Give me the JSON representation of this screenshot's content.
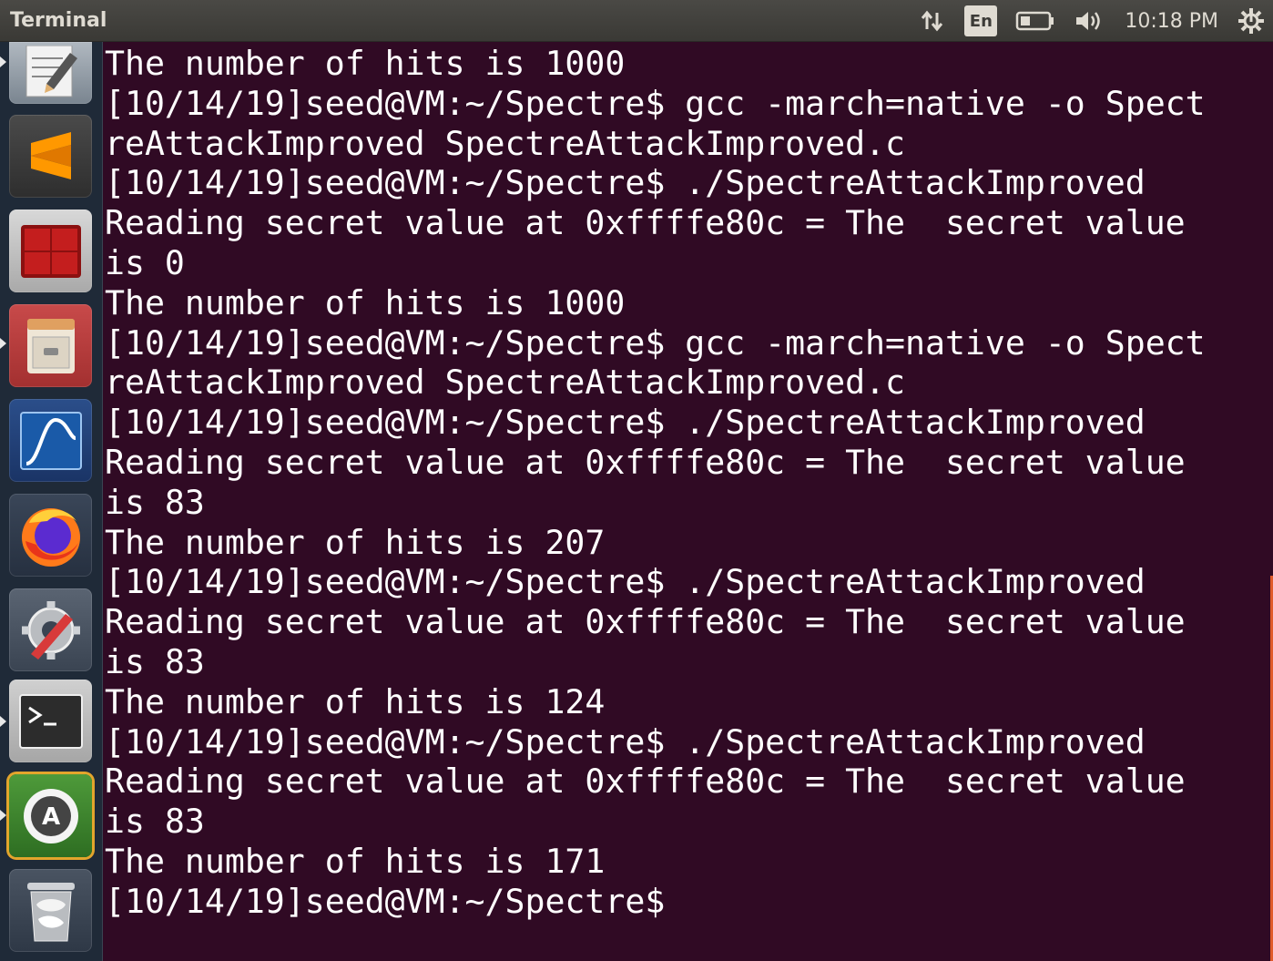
{
  "topbar": {
    "title": "Terminal",
    "keyboard_layout": "En",
    "clock": "10:18 PM"
  },
  "launcher": {
    "items": [
      {
        "name": "text-editor",
        "icon": "text-editor-icon"
      },
      {
        "name": "sublime-text",
        "icon": "sublime-text-icon"
      },
      {
        "name": "terminator",
        "icon": "terminator-icon"
      },
      {
        "name": "file-cabinet",
        "icon": "file-cabinet-icon"
      },
      {
        "name": "wireshark",
        "icon": "wireshark-icon"
      },
      {
        "name": "firefox",
        "icon": "firefox-icon"
      },
      {
        "name": "system-settings",
        "icon": "settings-icon"
      },
      {
        "name": "terminal",
        "icon": "terminal-icon"
      },
      {
        "name": "software-updater",
        "icon": "software-updater-icon"
      },
      {
        "name": "trash",
        "icon": "trash-icon"
      }
    ]
  },
  "terminal": {
    "lines": [
      "The number of hits is 1000",
      "[10/14/19]seed@VM:~/Spectre$ gcc -march=native -o Spect",
      "reAttackImproved SpectreAttackImproved.c",
      "[10/14/19]seed@VM:~/Spectre$ ./SpectreAttackImproved",
      "Reading secret value at 0xffffe80c = The  secret value",
      "is 0",
      "The number of hits is 1000",
      "[10/14/19]seed@VM:~/Spectre$ gcc -march=native -o Spect",
      "reAttackImproved SpectreAttackImproved.c",
      "[10/14/19]seed@VM:~/Spectre$ ./SpectreAttackImproved",
      "Reading secret value at 0xffffe80c = The  secret value",
      "is 83",
      "The number of hits is 207",
      "[10/14/19]seed@VM:~/Spectre$ ./SpectreAttackImproved",
      "Reading secret value at 0xffffe80c = The  secret value",
      "is 83",
      "The number of hits is 124",
      "[10/14/19]seed@VM:~/Spectre$ ./SpectreAttackImproved",
      "Reading secret value at 0xffffe80c = The  secret value",
      "is 83",
      "The number of hits is 171",
      "[10/14/19]seed@VM:~/Spectre$"
    ]
  },
  "colors": {
    "terminal_bg": "#300a24",
    "terminal_fg": "#ffffff",
    "topbar_bg": "#3c3b37",
    "launcher_bg": "#1f2a38"
  }
}
